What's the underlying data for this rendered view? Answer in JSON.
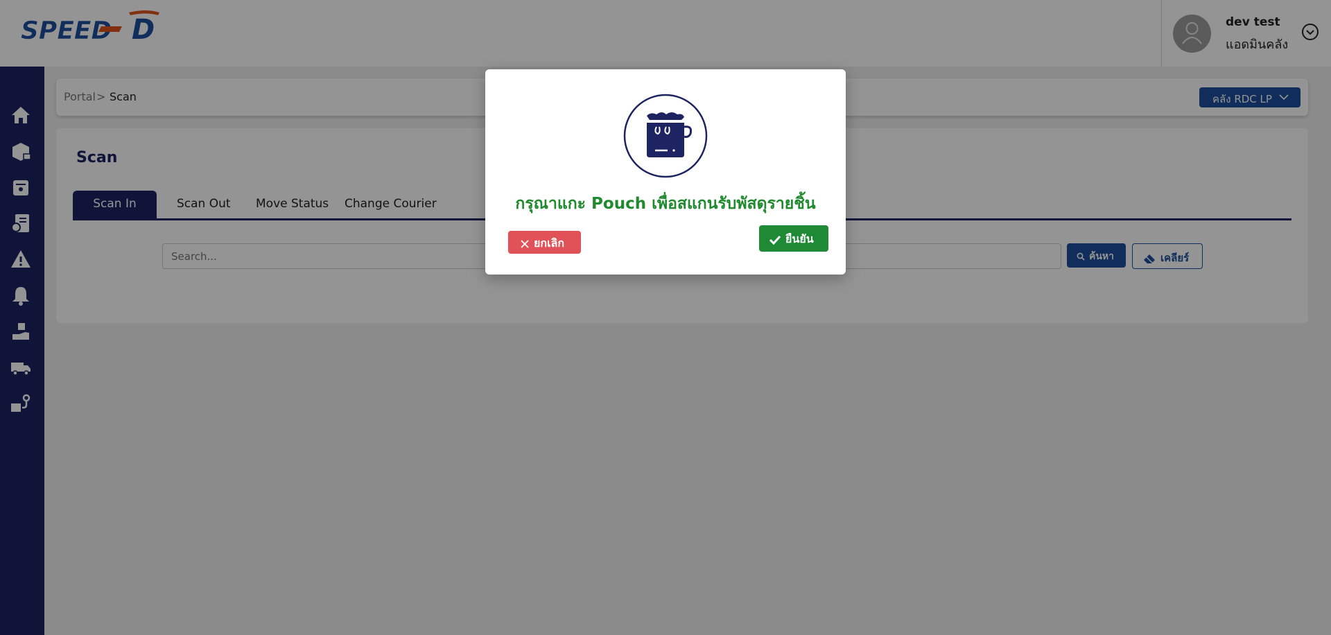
{
  "app": {
    "logo_text": "SPEED",
    "logo_letter": "D"
  },
  "user": {
    "name": "dev test",
    "role": "แอดมินคลัง"
  },
  "sidebar": {
    "icons": [
      "home-icon",
      "parcel-icon",
      "pouch-icon",
      "report-icon",
      "warning-icon",
      "notification-icon",
      "parcel-hand-icon",
      "truck-icon",
      "route-icon"
    ]
  },
  "breadcrumb": {
    "items": [
      "Portal",
      "Scan"
    ],
    "separator": ">"
  },
  "warehouse": {
    "label": "คลัง RDC LP"
  },
  "page": {
    "title": "Scan",
    "tabs": [
      {
        "label": "Scan In",
        "active": true
      },
      {
        "label": "Scan Out",
        "active": false
      },
      {
        "label": "Move Status",
        "active": false
      },
      {
        "label": "Change Courier",
        "active": false
      }
    ],
    "search": {
      "placeholder": "Search...",
      "search_label": "ค้นหา",
      "clear_label": "เคลียร์"
    }
  },
  "modal": {
    "icon": "pouch-bag-icon",
    "message": "กรุณาแกะ Pouch เพื่อสแกนรับพัสดุรายชิ้น",
    "cancel_label": "ยกเลิก",
    "confirm_label": "ยืนยัน"
  },
  "colors": {
    "navy": "#1d2461",
    "blue": "#1d4f9d",
    "success": "#1e8a35",
    "danger": "#e05258"
  }
}
